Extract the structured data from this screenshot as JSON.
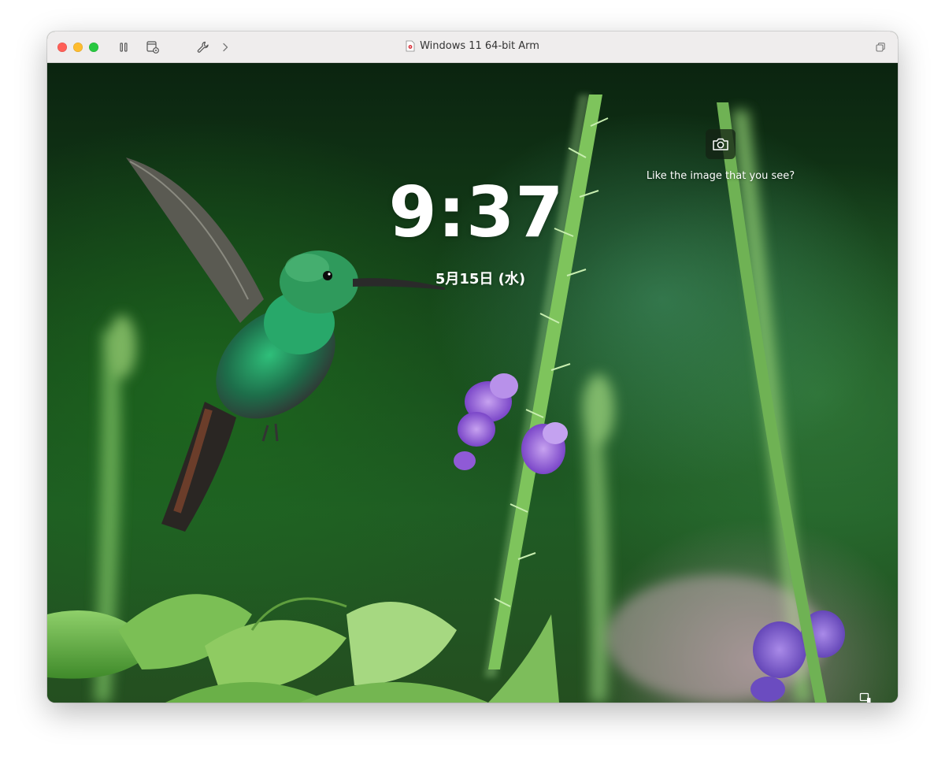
{
  "window": {
    "title": "Windows 11 64-bit Arm"
  },
  "toolbar": {
    "icons": [
      "pause-icon",
      "vm-settings-icon",
      "wrench-icon",
      "chevron-right-icon",
      "restore-window-icon"
    ]
  },
  "lock_screen": {
    "time": "9:37",
    "date": "5月15日 (水)",
    "spotlight_prompt": "Like the image that you see?",
    "spotlight_icon": "camera-icon",
    "corner_icon": "accessibility-icon"
  },
  "colors": {
    "close": "#ff5f57",
    "minimize": "#febc2e",
    "maximize": "#28c840",
    "titlebar": "#efeded"
  }
}
